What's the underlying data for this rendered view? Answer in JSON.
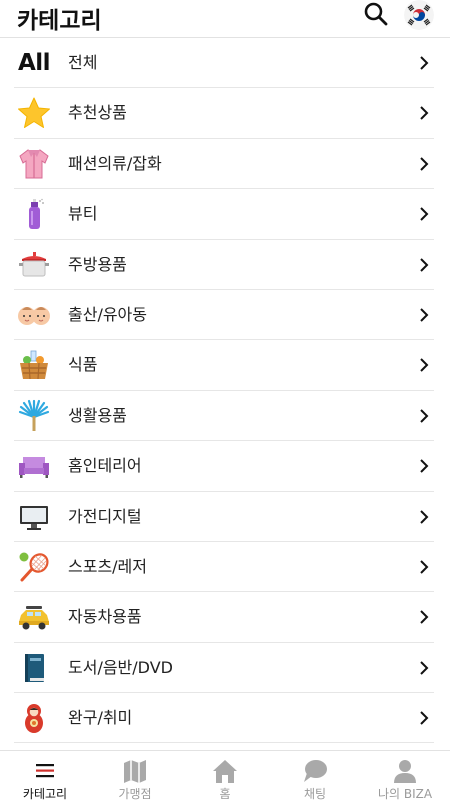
{
  "header": {
    "title": "카테고리"
  },
  "categories": [
    {
      "label": "전체",
      "icon_text": "All",
      "icon": "all-text"
    },
    {
      "label": "추천상품",
      "icon": "star-icon"
    },
    {
      "label": "패션의류/잡화",
      "icon": "clothing-icon"
    },
    {
      "label": "뷰티",
      "icon": "perfume-icon"
    },
    {
      "label": "주방용품",
      "icon": "pot-icon"
    },
    {
      "label": "출산/유아동",
      "icon": "babies-icon"
    },
    {
      "label": "식품",
      "icon": "food-basket-icon"
    },
    {
      "label": "생활용품",
      "icon": "duster-icon"
    },
    {
      "label": "홈인테리어",
      "icon": "sofa-icon"
    },
    {
      "label": "가전디지털",
      "icon": "monitor-icon"
    },
    {
      "label": "스포츠/레저",
      "icon": "tennis-icon"
    },
    {
      "label": "자동차용품",
      "icon": "car-icon"
    },
    {
      "label": "도서/음반/DVD",
      "icon": "book-icon"
    },
    {
      "label": "완구/취미",
      "icon": "doll-icon"
    }
  ],
  "tabbar": {
    "tabs": [
      {
        "label": "카테고리",
        "icon": "menu-icon",
        "active": true
      },
      {
        "label": "가맹점",
        "icon": "map-icon",
        "active": false
      },
      {
        "label": "홈",
        "icon": "home-icon",
        "active": false
      },
      {
        "label": "채팅",
        "icon": "chat-icon",
        "active": false
      },
      {
        "label": "나의 BIZA",
        "icon": "user-icon",
        "active": false
      }
    ]
  }
}
